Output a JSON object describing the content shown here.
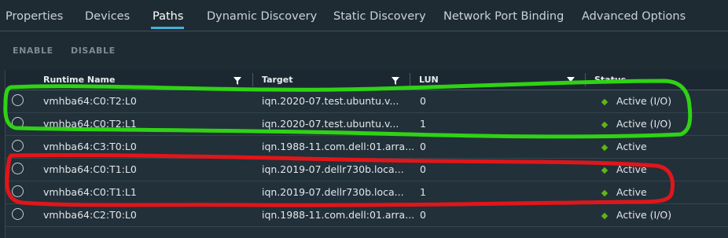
{
  "tabs": [
    {
      "label": "Properties"
    },
    {
      "label": "Devices"
    },
    {
      "label": "Paths"
    },
    {
      "label": "Dynamic Discovery"
    },
    {
      "label": "Static Discovery"
    },
    {
      "label": "Network Port Binding"
    },
    {
      "label": "Advanced Options"
    }
  ],
  "active_tab": "Paths",
  "actions": {
    "enable": "ENABLE",
    "disable": "DISABLE"
  },
  "columns": [
    "Runtime Name",
    "Target",
    "LUN",
    "Status"
  ],
  "rows": [
    {
      "runtime_name": "vmhba64:C0:T2:L0",
      "target": "iqn.2020-07.test.ubuntu.v...",
      "lun": "0",
      "status": "Active (I/O)"
    },
    {
      "runtime_name": "vmhba64:C0:T2:L1",
      "target": "iqn.2020-07.test.ubuntu.v...",
      "lun": "1",
      "status": "Active (I/O)"
    },
    {
      "runtime_name": "vmhba64:C3:T0:L0",
      "target": "iqn.1988-11.com.dell:01.arra...",
      "lun": "0",
      "status": "Active"
    },
    {
      "runtime_name": "vmhba64:C0:T1:L0",
      "target": "iqn.2019-07.dellr730b.loca...",
      "lun": "0",
      "status": "Active"
    },
    {
      "runtime_name": "vmhba64:C0:T1:L1",
      "target": "iqn.2019-07.dellr730b.loca...",
      "lun": "1",
      "status": "Active"
    },
    {
      "runtime_name": "vmhba64:C2:T0:L0",
      "target": "iqn.1988-11.com.dell:01.arra...",
      "lun": "0",
      "status": "Active (I/O)"
    }
  ],
  "colors": {
    "accent": "#49afd9",
    "status_active": "#60b515",
    "annotation_green": "#2fd314",
    "annotation_red": "#e0161a"
  }
}
